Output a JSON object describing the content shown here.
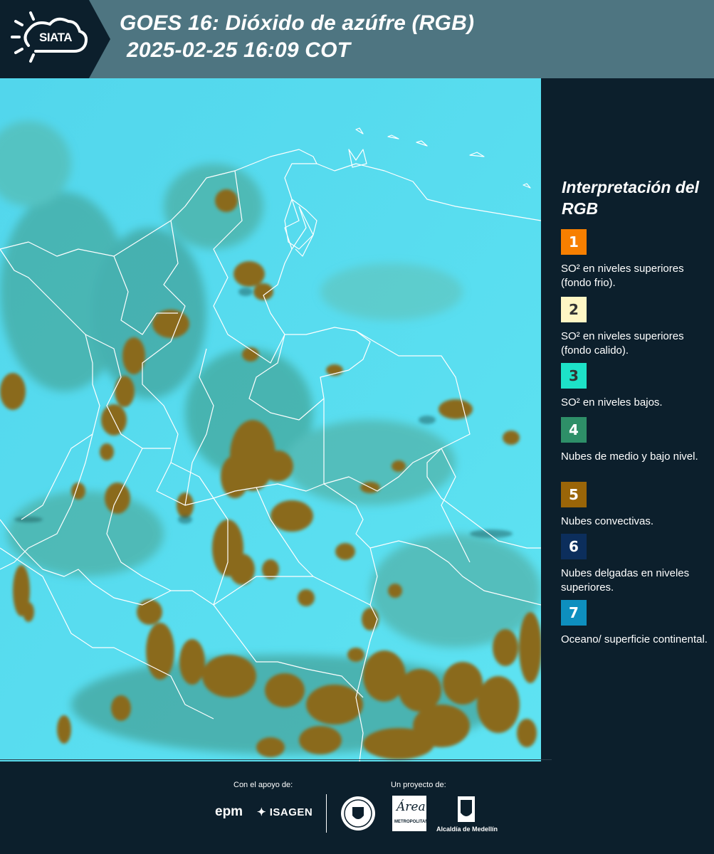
{
  "header": {
    "logo_text": "SIATA",
    "title_line_1": "GOES 16: Dióxido de azúfre (RGB)",
    "title_line_2": "2025-02-25 16:09 COT",
    "background_color": "#4e7581",
    "logo_panel_color": "#0c1f2c"
  },
  "map": {
    "description_icon": "satellite-rgb-map",
    "ocean_color": "#3fd3ee",
    "cloud_color": "#8a6a1e",
    "border_color": "#ffffff"
  },
  "legend": {
    "title": "Interpretación del RGB",
    "items": [
      {
        "number": "1",
        "color": "#f77f00",
        "number_color": "#ffffff",
        "text": "SO² en niveles superiores (fondo frio)."
      },
      {
        "number": "2",
        "color": "#fff6c4",
        "number_color": "#333333",
        "text": "SO² en niveles superiores (fondo calido)."
      },
      {
        "number": "3",
        "color": "#1de2c8",
        "number_color": "#333333",
        "text": "SO² en niveles bajos."
      },
      {
        "number": "4",
        "color": "#2e8f68",
        "number_color": "#ffffff",
        "text": "Nubes de medio y bajo nivel."
      },
      {
        "number": "5",
        "color": "#9a6508",
        "number_color": "#ffffff",
        "text": "Nubes convectivas."
      },
      {
        "number": "6",
        "color": "#0c2e5c",
        "number_color": "#ffffff",
        "text": "Nubes delgadas en niveles superiores."
      },
      {
        "number": "7",
        "color": "#0e8fbf",
        "number_color": "#ffffff",
        "text": "Oceano/ superficie continental."
      }
    ]
  },
  "footer": {
    "support_label": "Con el apoyo de:",
    "project_label": "Un proyecto de:",
    "sponsor_1": "epm",
    "sponsor_2": "ISAGEN",
    "partner_1_icon": "medellin-seal-icon",
    "partner_2": "Área",
    "partner_2_sub": "METROPOLITANA",
    "partner_3": "Alcaldía de Medellín"
  }
}
